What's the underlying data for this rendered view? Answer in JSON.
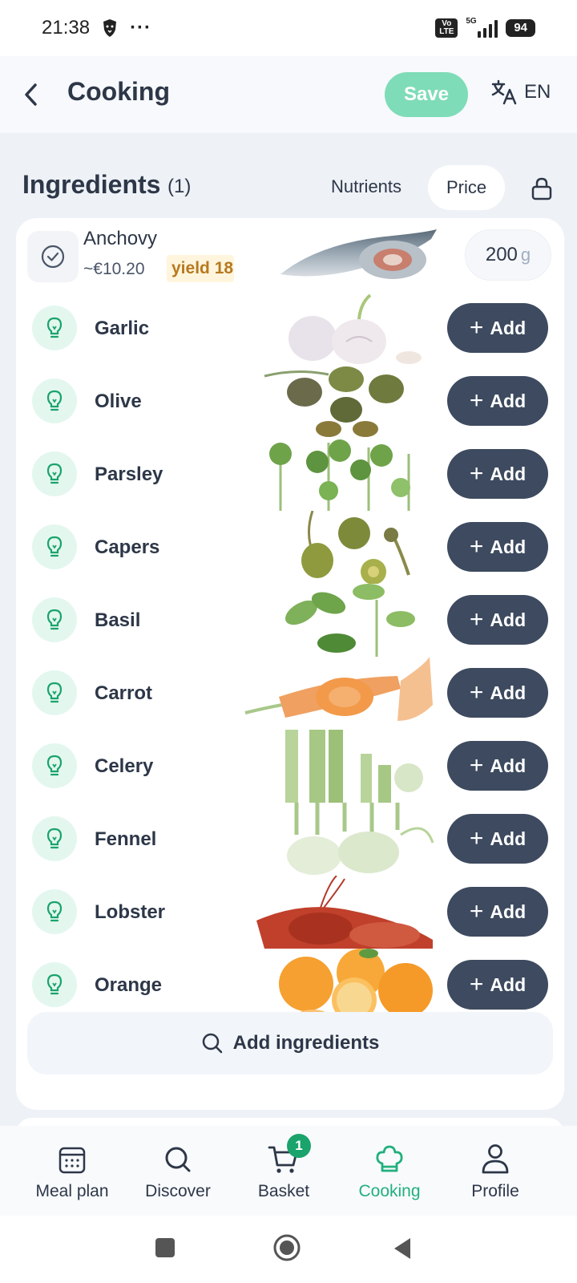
{
  "status_bar": {
    "time": "21:38",
    "dots": "···",
    "volte": "Vo LTE",
    "network": "5G",
    "battery": "94"
  },
  "header": {
    "title": "Cooking",
    "save_label": "Save",
    "lang_label": "EN",
    "accent": "#7fdcb8"
  },
  "ingredients": {
    "title": "Ingredients",
    "count": "(1)",
    "tabs": [
      "Nutrients",
      "Price"
    ],
    "selected_tab": "Price"
  },
  "added_item": {
    "name": "Anchovy",
    "price": "~€10.20",
    "yield_label": "yield 18",
    "quantity": "200",
    "unit": "g"
  },
  "suggestions": [
    {
      "name": "Garlic",
      "add_label": "Add"
    },
    {
      "name": "Olive",
      "add_label": "Add"
    },
    {
      "name": "Parsley",
      "add_label": "Add"
    },
    {
      "name": "Capers",
      "add_label": "Add"
    },
    {
      "name": "Basil",
      "add_label": "Add"
    },
    {
      "name": "Carrot",
      "add_label": "Add"
    },
    {
      "name": "Celery",
      "add_label": "Add"
    },
    {
      "name": "Fennel",
      "add_label": "Add"
    },
    {
      "name": "Lobster",
      "add_label": "Add"
    },
    {
      "name": "Orange",
      "add_label": "Add"
    }
  ],
  "add_ingredients_label": "Add ingredients",
  "bottom_nav": {
    "items": [
      {
        "label": "Meal plan",
        "icon": "calendar-icon"
      },
      {
        "label": "Discover",
        "icon": "search-icon"
      },
      {
        "label": "Basket",
        "icon": "cart-icon",
        "badge": "1"
      },
      {
        "label": "Cooking",
        "icon": "chef-hat-icon"
      },
      {
        "label": "Profile",
        "icon": "person-icon"
      }
    ],
    "active": "Cooking",
    "active_color": "#22b07d"
  }
}
